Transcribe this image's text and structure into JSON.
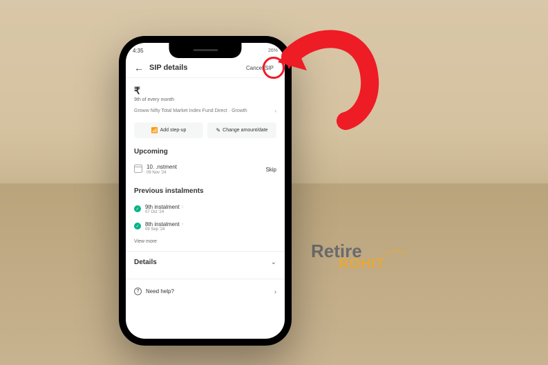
{
  "status_bar": {
    "time": "4:35",
    "battery": "26%"
  },
  "header": {
    "title": "SIP details",
    "cancel_label": "Cancel SIP"
  },
  "sip": {
    "rupee": "₹",
    "schedule": "9th of every month",
    "fund_name": "Groww Nifty Total Market Index Fund Direct · Growth"
  },
  "actions": {
    "step_up": "Add step-up",
    "change": "Change amount/date"
  },
  "upcoming": {
    "title": "Upcoming",
    "item_title": "10.      .nstment",
    "item_date": "09 Nov '24",
    "skip": "Skip"
  },
  "previous": {
    "title": "Previous instalments",
    "items": [
      {
        "title": "9th instalment",
        "date": "07 Oct '24"
      },
      {
        "title": "8th instalment",
        "date": "09 Sep '24"
      }
    ],
    "view_more": "View more"
  },
  "details": {
    "title": "Details"
  },
  "help": {
    "label": "Need help?"
  },
  "watermark": {
    "line1": "Retire",
    "line2": "ROHIT"
  }
}
